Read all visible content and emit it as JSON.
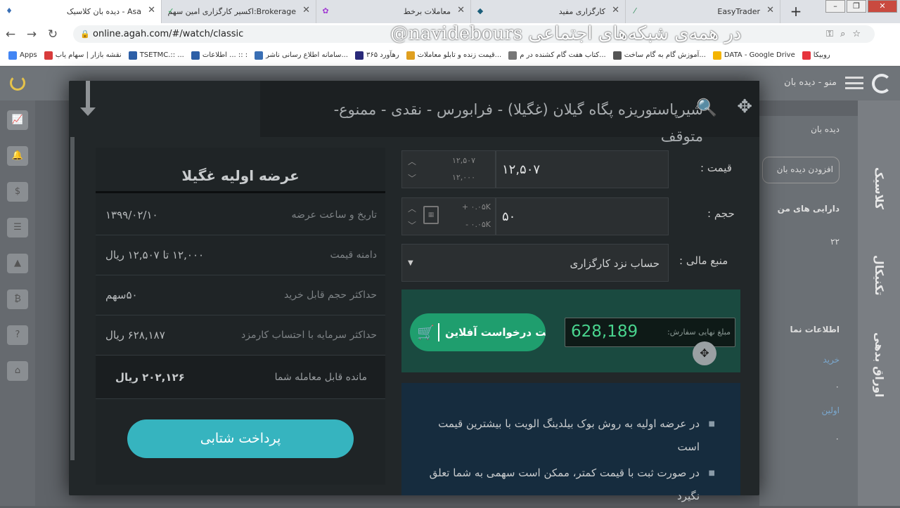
{
  "browser": {
    "tabs": [
      {
        "label": "دیده بان کلاسیک - Asa",
        "color": "#3a6fb5",
        "icon": "ribbon-icon"
      },
      {
        "label": "اکسیر کارگزاری امین سهم:Brokerage",
        "color": "#3aa860",
        "icon": "check-icon"
      },
      {
        "label": "معاملات برخط",
        "color": "#a13dd2",
        "icon": "flower-icon"
      },
      {
        "label": "کارگزاری مفید",
        "color": "#1b5e7a",
        "icon": "diamond-icon"
      },
      {
        "label": "EasyTrader",
        "color": "#2e8b57",
        "icon": "leaf-icon"
      }
    ],
    "url": "online.agah.com/#/watch/classic",
    "bookmarks": [
      {
        "label": "Apps",
        "color": "#4285f4"
      },
      {
        "label": "نقشه بازار | سهام یاب",
        "color": "#d83b3b"
      },
      {
        "label": "TSETMC.:: ...",
        "color": "#2d5fa7"
      },
      {
        "label": "اطلاعات ... :: :",
        "color": "#2d5fa7"
      },
      {
        "label": "سامانه اطلاع رسانی ناشر...",
        "color": "#3a6fb5"
      },
      {
        "label": "رهآورد ۳۶۵",
        "color": "#2a2a7a"
      },
      {
        "label": "قیمت زنده و تابلو معاملات...",
        "color": "#e0a020"
      },
      {
        "label": "کتاب هفت گام کشنده در م...",
        "color": "#777777"
      },
      {
        "label": "آموزش گام به گام ساخت...",
        "color": "#555555"
      },
      {
        "label": "DATA - Google Drive",
        "color": "#f4b400"
      },
      {
        "label": "روبیکا",
        "color": "#e6343d"
      }
    ]
  },
  "watermark": "@navidebours در همه‌ی شبکه‌های اجتماعی",
  "app": {
    "menu_label": "منو - دیده بان",
    "right_tabs": [
      "کلاسیک",
      "تکنیکال",
      "اوراق بدهی"
    ],
    "watch_title": "دیده بان",
    "add_watch": "افزودن دیده بان",
    "assets": "دارایی های من",
    "count": "۲۲",
    "info": "اطلاعات نما",
    "buy": "خرید",
    "zero1": "۰",
    "first": "اولین",
    "zero2": "۰"
  },
  "modal": {
    "title": "شیرپاستوریزه پگاه گیلان (غگیلا) - فرابورس - نقدی - ممنوع-متوقف",
    "form": {
      "price_label": "قیمت :",
      "price_value": "۱۲,۵۰۷",
      "price_max": "۱۲,۵۰۷",
      "price_min": "۱۲,۰۰۰",
      "volume_label": "حجم :",
      "volume_value": "۵۰",
      "volume_plus": "+ ۰.۰۵K",
      "volume_minus": "- ۰.۰۵K",
      "source_label": "منبع مالی :",
      "source_value": "حساب نزد کارگزاری",
      "submit_label": "ثبت درخواست آفلاین",
      "total_label": "مبلغ نهایی سفارش:",
      "total_value": "628,189"
    },
    "notes": [
      "در عرضه اولیه به روش بوک بیلدینگ الویت با بیشترین قیمت است",
      "در صورت ثبت با قیمت کمتر، ممکن است سهمی به شما تعلق نگیرد"
    ],
    "ipo": {
      "title": "عرضه اولیه غگیلا",
      "rows": [
        {
          "key": "تاریخ و ساعت عرضه",
          "value": "۱۳۹۹/۰۲/۱۰"
        },
        {
          "key": "دامنه قیمت",
          "value": "۱۲,۰۰۰ تا ۱۲,۵۰۷ ریال"
        },
        {
          "key": "حداکثر حجم قابل خرید",
          "value": "۵۰سهم"
        },
        {
          "key": "حداکثر سرمایه با احتساب کارمزد",
          "value": "۶۲۸,۱۸۷ ریال"
        },
        {
          "key": "مانده قابل معامله شما",
          "value": "۲۰۲,۱۲۶ ریال"
        }
      ],
      "pay_label": "پرداخت شتابی"
    }
  }
}
